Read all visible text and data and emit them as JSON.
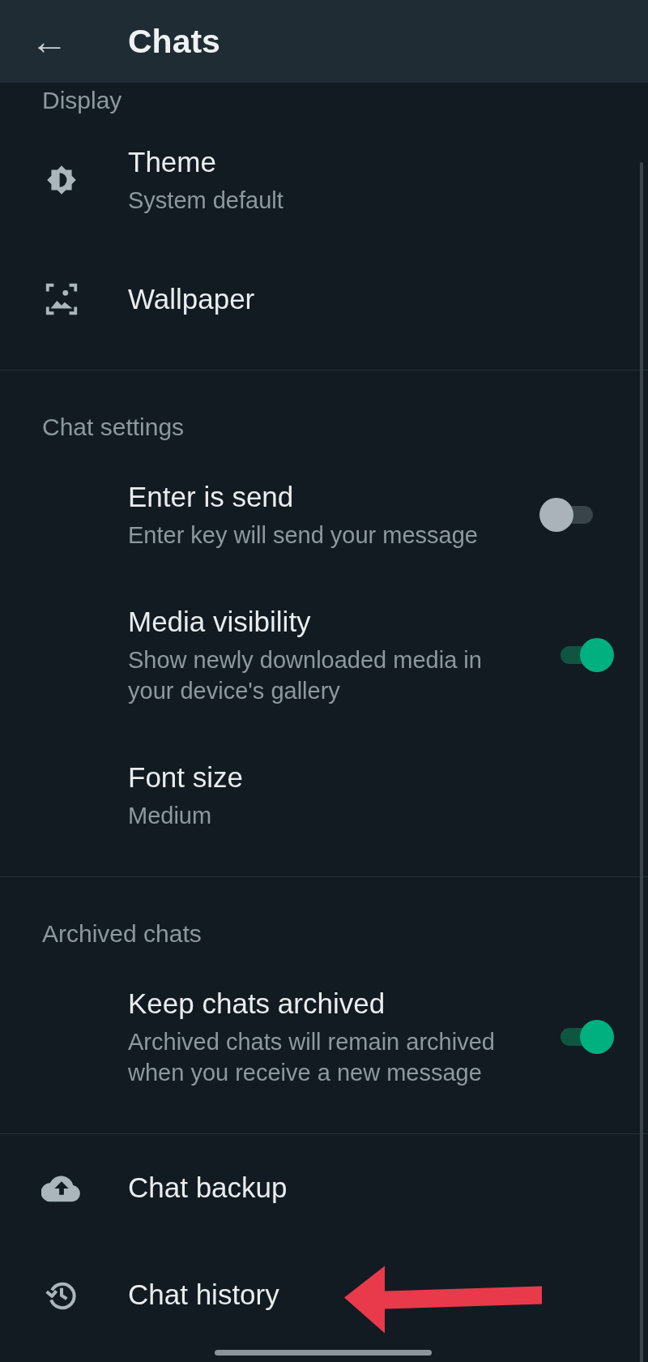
{
  "header": {
    "back_icon": "←",
    "title": "Chats"
  },
  "sections": [
    {
      "title": "Display",
      "items": [
        {
          "kind": "plain",
          "title": "Theme",
          "subtitle": "System default"
        },
        {
          "kind": "plain",
          "title": "Wallpaper"
        }
      ]
    },
    {
      "title": "Chat settings",
      "items": [
        {
          "kind": "toggle",
          "title": "Enter is send",
          "subtitle": "Enter key will send your message",
          "on": false
        },
        {
          "kind": "toggle",
          "title": "Media visibility",
          "subtitle": "Show newly downloaded media in your device's gallery",
          "on": true
        },
        {
          "kind": "plain",
          "title": "Font size",
          "subtitle": "Medium"
        }
      ]
    },
    {
      "title": "Archived chats",
      "items": [
        {
          "kind": "toggle",
          "title": "Keep chats archived",
          "subtitle": "Archived chats will remain archived when you receive a new message",
          "on": true
        }
      ]
    },
    {
      "items": [
        {
          "kind": "plain",
          "title": "Chat backup"
        },
        {
          "kind": "plain",
          "title": "Chat history",
          "annotated": true
        }
      ]
    }
  ]
}
